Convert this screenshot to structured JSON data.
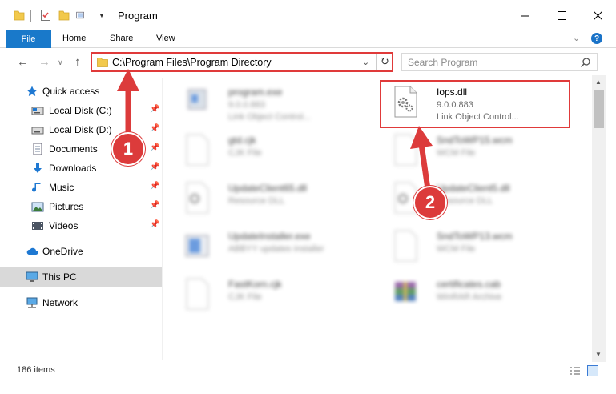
{
  "window": {
    "title": "Program",
    "minimize_icon": "minimize-icon",
    "maximize_icon": "maximize-icon",
    "close_icon": "close-icon"
  },
  "ribbon": {
    "file": "File",
    "home": "Home",
    "share": "Share",
    "view": "View"
  },
  "address": {
    "path": "C:\\Program Files\\Program Directory",
    "search_placeholder": "Search Program"
  },
  "sidebar": {
    "items": [
      {
        "label": "Quick access",
        "icon": "star-icon",
        "pinned": false
      },
      {
        "label": "Local Disk (C:)",
        "icon": "drive-icon",
        "pinned": true
      },
      {
        "label": "Local Disk (D:)",
        "icon": "drive-icon",
        "pinned": true
      },
      {
        "label": "Documents",
        "icon": "documents-icon",
        "pinned": true
      },
      {
        "label": "Downloads",
        "icon": "download-icon",
        "pinned": true
      },
      {
        "label": "Music",
        "icon": "music-icon",
        "pinned": true
      },
      {
        "label": "Pictures",
        "icon": "pictures-icon",
        "pinned": true
      },
      {
        "label": "Videos",
        "icon": "videos-icon",
        "pinned": true
      },
      {
        "label": "OneDrive",
        "icon": "cloud-icon",
        "pinned": false
      },
      {
        "label": "This PC",
        "icon": "computer-icon",
        "pinned": false
      },
      {
        "label": "Network",
        "icon": "network-icon",
        "pinned": false
      }
    ]
  },
  "files": [
    {
      "name": "program.exe",
      "line2": "9.0.0.883",
      "line3": "Link Object Control...",
      "icon": "exe-icon"
    },
    {
      "name": "Iops.dll",
      "line2": "9.0.0.883",
      "line3": "Link Object Control...",
      "icon": "dll-gear-icon"
    },
    {
      "name": "gtd.cjk",
      "line2": "CJK File",
      "line3": "",
      "icon": "blank-file-icon"
    },
    {
      "name": "SndToWP15.wcm",
      "line2": "WCM File",
      "line3": "",
      "icon": "blank-file-icon"
    },
    {
      "name": "UpdateClient65.dll",
      "line2": "Resource DLL",
      "line3": "",
      "icon": "dll-gear-icon"
    },
    {
      "name": "UpdateClient5.dll",
      "line2": "Resource DLL",
      "line3": "",
      "icon": "dll-gear-icon"
    },
    {
      "name": "UpdateInstaller.exe",
      "line2": "ABBYY updates installer",
      "line3": "",
      "icon": "installer-icon"
    },
    {
      "name": "SndToWP13.wcm",
      "line2": "WCM File",
      "line3": "",
      "icon": "blank-file-icon"
    },
    {
      "name": "FastKorn.cjk",
      "line2": "CJK File",
      "line3": "",
      "icon": "blank-file-icon"
    },
    {
      "name": "certificates.cab",
      "line2": "WinRAR Archive",
      "line3": "",
      "icon": "archive-icon"
    }
  ],
  "status": {
    "count": "186 items"
  },
  "annotations": {
    "badge1": "1",
    "badge2": "2",
    "color": "#dc3b3b"
  }
}
